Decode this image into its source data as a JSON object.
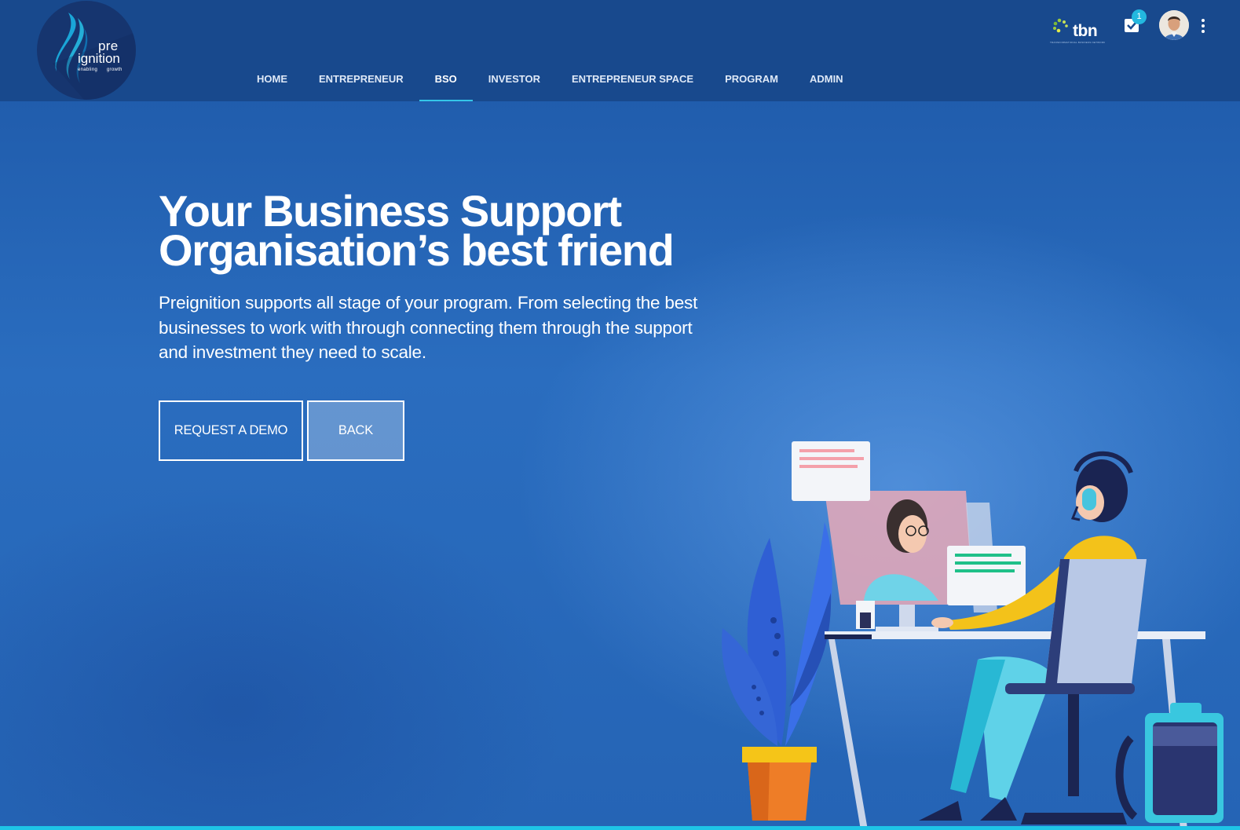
{
  "logo": {
    "line1": "pre",
    "line2": "ignition",
    "tagline": "enabling      growth"
  },
  "nav": {
    "items": [
      {
        "label": "HOME"
      },
      {
        "label": "ENTREPRENEUR"
      },
      {
        "label": "BSO",
        "active": true
      },
      {
        "label": "INVESTOR"
      },
      {
        "label": "ENTREPRENEUR SPACE"
      },
      {
        "label": "PROGRAM"
      },
      {
        "label": "ADMIN"
      }
    ]
  },
  "header_right": {
    "partner_logo_text": "tbn",
    "partner_logo_subtext": "TRANSFORMATIONAL BUSINESS NETWORK",
    "tasks_icon": "checklist-icon",
    "tasks_badge": "1",
    "avatar_icon": "user-avatar",
    "menu_icon": "more-vertical-icon"
  },
  "hero": {
    "title": "Your Business Support Organisation’s best friend",
    "subtitle": "Preignition supports all stage of your program. From selecting the best businesses to work with through connecting them through the support and investment they need to scale.",
    "primary_button": "REQUEST A DEMO",
    "secondary_button": "BACK"
  },
  "colors": {
    "header_bg": "#18498d",
    "hero_bg": "#2564b5",
    "accent": "#35c6e8"
  }
}
